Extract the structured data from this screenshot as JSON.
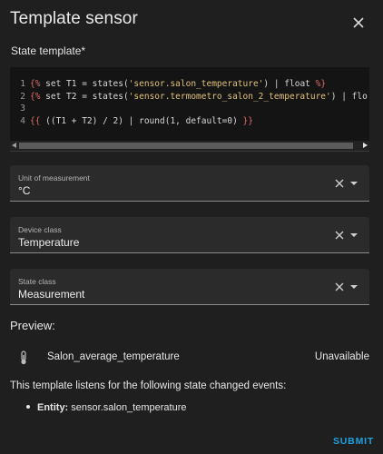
{
  "dialog": {
    "title": "Template sensor",
    "close_icon": "close-icon"
  },
  "template": {
    "label": "State template*",
    "line_numbers": [
      "1",
      "2",
      "3",
      "4"
    ],
    "lines": [
      [
        {
          "t": "kw",
          "v": "{%"
        },
        {
          "t": "tx",
          "v": " set T1 = states("
        },
        {
          "t": "str",
          "v": "'sensor.salon_temperature'"
        },
        {
          "t": "tx",
          "v": ") | float "
        },
        {
          "t": "kw",
          "v": "%}"
        }
      ],
      [
        {
          "t": "kw",
          "v": "{%"
        },
        {
          "t": "tx",
          "v": " set T2 = states("
        },
        {
          "t": "str",
          "v": "'sensor.termometro_salon_2_temperature'"
        },
        {
          "t": "tx",
          "v": ") | flo"
        }
      ],
      [],
      [
        {
          "t": "kw",
          "v": "{{"
        },
        {
          "t": "tx",
          "v": " ((T1 + T2) / 2) | round(1, default=0) "
        },
        {
          "t": "kw",
          "v": "}}"
        }
      ]
    ]
  },
  "fields": {
    "unit": {
      "label": "Unit of measurement",
      "value": "°C"
    },
    "device_class": {
      "label": "Device class",
      "value": "Temperature"
    },
    "state_class": {
      "label": "State class",
      "value": "Measurement"
    }
  },
  "preview": {
    "label": "Preview:",
    "entity_icon": "thermometer-icon",
    "entity_name": "Salon_average_temperature",
    "entity_state": "Unavailable",
    "listen_text": "This template listens for the following state changed events:",
    "listen_items": [
      {
        "kind": "Entity:",
        "value": "sensor.salon_temperature"
      }
    ]
  },
  "actions": {
    "submit_label": "SUBMIT"
  },
  "colors": {
    "accent": "#1ea0e0",
    "keyword": "#e26b6b",
    "string": "#e0c07a"
  }
}
